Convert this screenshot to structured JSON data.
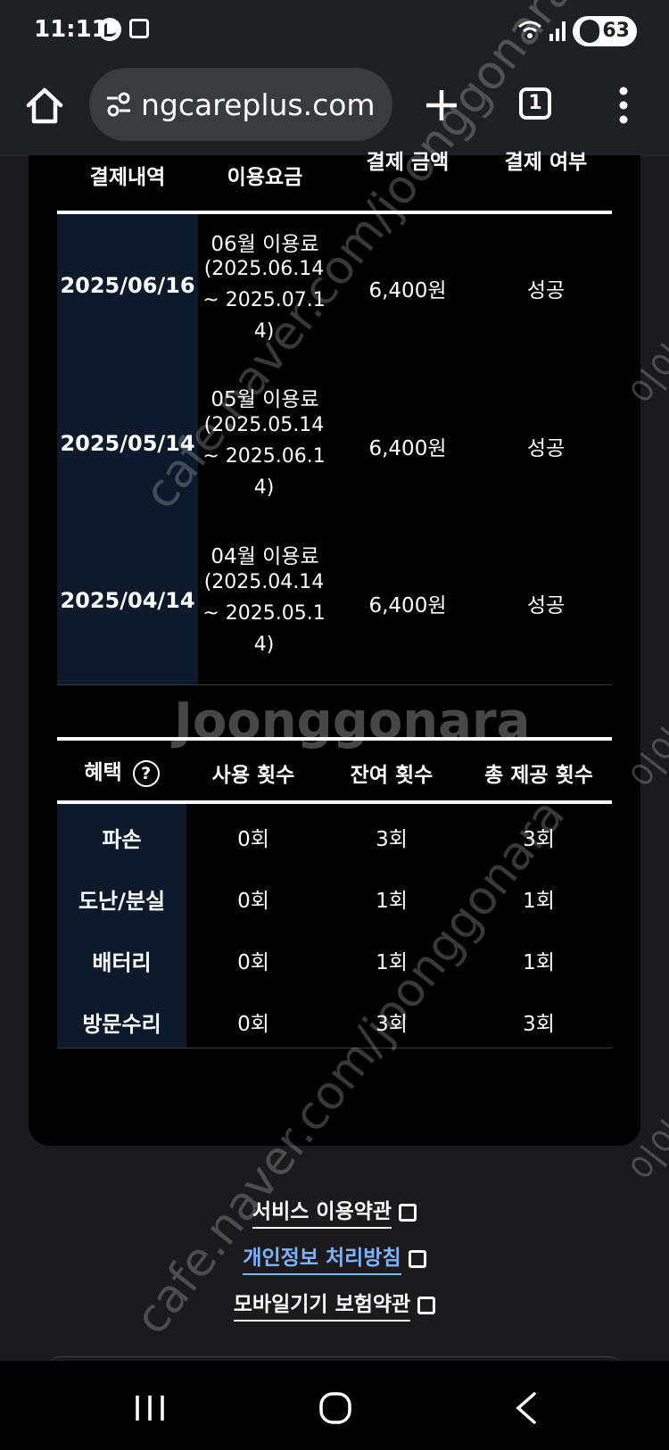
{
  "status_bar": {
    "time": "11:11",
    "battery": "63"
  },
  "browser": {
    "url": "ngcareplus.com",
    "tab_count": "1"
  },
  "payment_table": {
    "headers": [
      "결제내역",
      "이용요금",
      "결제 금액",
      "결제 여부"
    ],
    "rows": [
      {
        "date": "2025/06/16",
        "fee_label": "06월 이용료",
        "period": "(2025.06.14 ~ 2025.07.14)",
        "amount": "6,400원",
        "status": "성공"
      },
      {
        "date": "2025/05/14",
        "fee_label": "05월 이용료",
        "period": "(2025.05.14 ~ 2025.06.14)",
        "amount": "6,400원",
        "status": "성공"
      },
      {
        "date": "2025/04/14",
        "fee_label": "04월 이용료",
        "period": "(2025.04.14 ~ 2025.05.14)",
        "amount": "6,400원",
        "status": "성공"
      }
    ]
  },
  "benefit_table": {
    "headers": [
      "혜택",
      "사용 횟수",
      "잔여 횟수",
      "총 제공 횟수"
    ],
    "help_symbol": "?",
    "rows": [
      {
        "name": "파손",
        "used": "0회",
        "remaining": "3회",
        "total": "3회"
      },
      {
        "name": "도난/분실",
        "used": "0회",
        "remaining": "1회",
        "total": "1회"
      },
      {
        "name": "배터리",
        "used": "0회",
        "remaining": "1회",
        "total": "1회"
      },
      {
        "name": "방문수리",
        "used": "0회",
        "remaining": "3회",
        "total": "3회"
      }
    ]
  },
  "footer_links": [
    "서비스 이용약관",
    "개인정보 처리방침",
    "모바일기기 보험약관"
  ],
  "colors": {
    "accent_link": "#7fb2ff",
    "header_column": "#0c1a2b",
    "card": "#000000",
    "page": "#1b1b1d"
  },
  "watermark": {
    "brand": "Joonggonara",
    "url": "cafe.naver.com/joonggonara",
    "badge": "이이"
  }
}
